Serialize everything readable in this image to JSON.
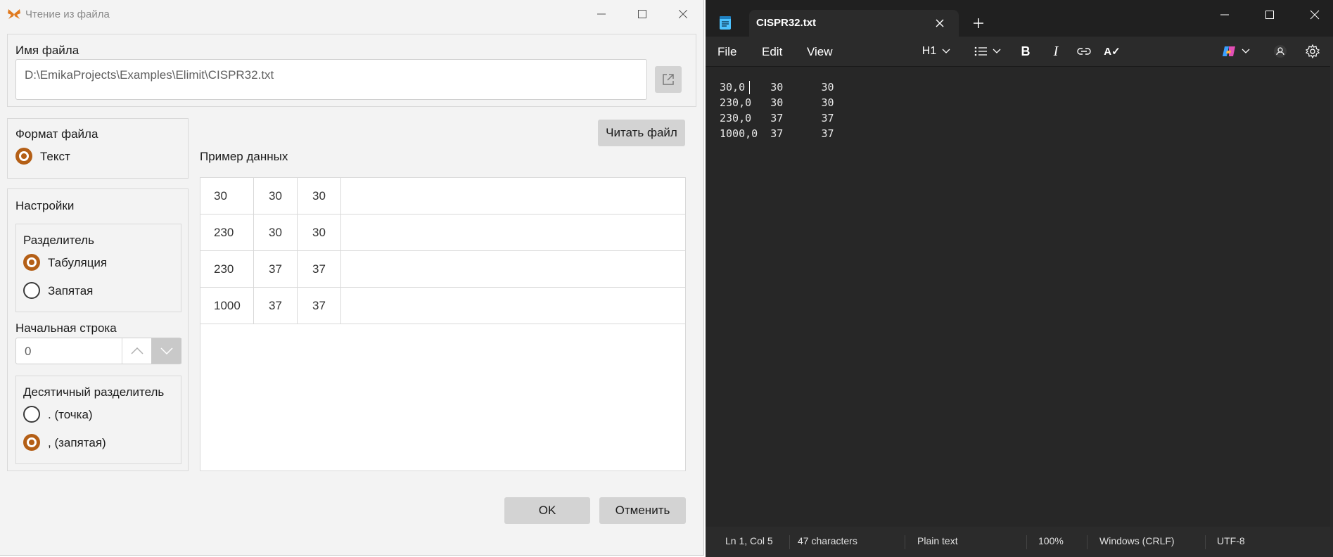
{
  "dialog": {
    "title": "Чтение из файла",
    "file_name_label": "Имя файла",
    "file_path": "D:\\EmikaProjects\\Examples\\Elimit\\CISPR32.txt",
    "file_format_label": "Формат файла",
    "format_text_label": "Текст",
    "settings_label": "Настройки",
    "separator_label": "Разделитель",
    "separator_tab_label": "Табуляция",
    "separator_comma_label": "Запятая",
    "start_row_label": "Начальная строка",
    "start_row_value": "0",
    "decimal_label": "Десятичный разделитель",
    "decimal_dot_label": ". (точка)",
    "decimal_comma_label": ", (запятая)",
    "read_file_button": "Читать файл",
    "sample_data_label": "Пример данных",
    "sample_rows": [
      [
        "30",
        "30",
        "30"
      ],
      [
        "230",
        "30",
        "30"
      ],
      [
        "230",
        "37",
        "37"
      ],
      [
        "1000",
        "37",
        "37"
      ]
    ],
    "ok_button": "OK",
    "cancel_button": "Отменить",
    "accent_color": "#b45f16"
  },
  "notepad": {
    "tab_title": "CISPR32.txt",
    "menu": {
      "file": "File",
      "edit": "Edit",
      "view": "View"
    },
    "heading_label": "H1",
    "lines": [
      "30,0    30      30",
      "230,0   30      30",
      "230,0   37      37",
      "1000,0  37      37"
    ],
    "status": {
      "position": "Ln 1, Col 5",
      "characters": "47 characters",
      "format": "Plain text",
      "zoom": "100%",
      "line_endings": "Windows (CRLF)",
      "encoding": "UTF-8"
    }
  }
}
